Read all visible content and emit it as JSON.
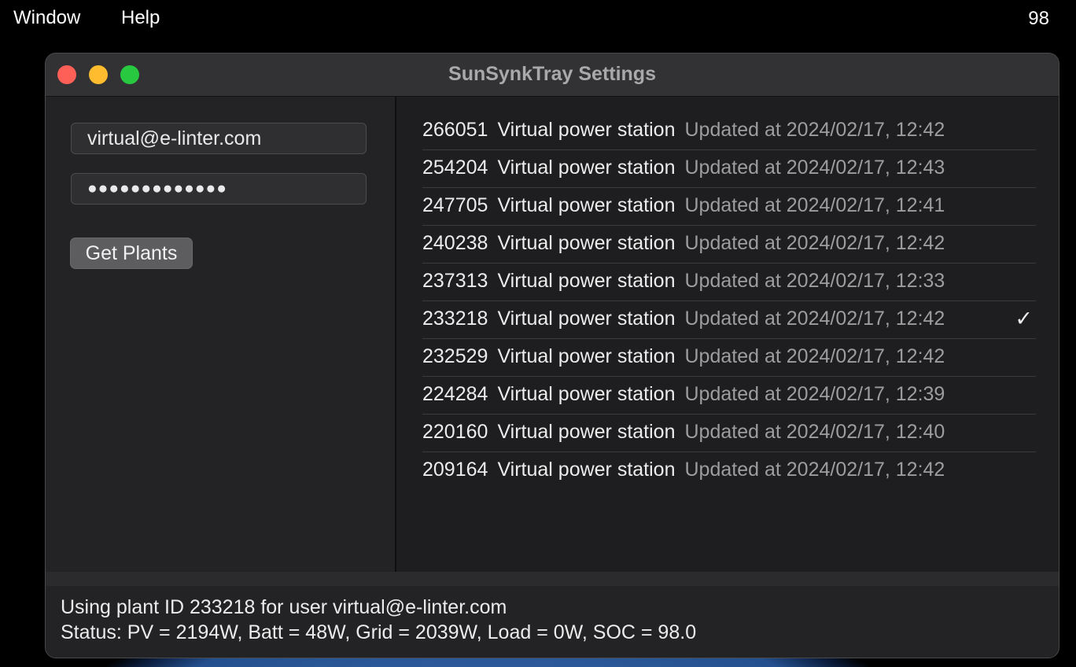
{
  "menubar": {
    "items": [
      "Window",
      "Help"
    ],
    "right_text": "98"
  },
  "window": {
    "title": "SunSynkTray Settings"
  },
  "login": {
    "email": "virtual@e-linter.com",
    "password_mask": "●●●●●●●●●●●●●",
    "get_plants_label": "Get Plants"
  },
  "plants": [
    {
      "id": "266051",
      "name": "Virtual power station",
      "updated": "Updated at 2024/02/17, 12:42",
      "selected": false
    },
    {
      "id": "254204",
      "name": "Virtual power station",
      "updated": "Updated at 2024/02/17, 12:43",
      "selected": false
    },
    {
      "id": "247705",
      "name": "Virtual power station",
      "updated": "Updated at 2024/02/17, 12:41",
      "selected": false
    },
    {
      "id": "240238",
      "name": "Virtual power station",
      "updated": "Updated at 2024/02/17, 12:42",
      "selected": false
    },
    {
      "id": "237313",
      "name": "Virtual power station",
      "updated": "Updated at 2024/02/17, 12:33",
      "selected": false
    },
    {
      "id": "233218",
      "name": "Virtual power station",
      "updated": "Updated at 2024/02/17, 12:42",
      "selected": true,
      "mark": "✓"
    },
    {
      "id": "232529",
      "name": "Virtual power station",
      "updated": "Updated at 2024/02/17, 12:42",
      "selected": false
    },
    {
      "id": "224284",
      "name": "Virtual power station",
      "updated": "Updated at 2024/02/17, 12:39",
      "selected": false
    },
    {
      "id": "220160",
      "name": "Virtual power station",
      "updated": "Updated at 2024/02/17, 12:40",
      "selected": false
    },
    {
      "id": "209164",
      "name": "Virtual power station",
      "updated": "Updated at 2024/02/17, 12:42",
      "selected": false
    }
  ],
  "status": {
    "line1": "Using plant ID 233218 for user virtual@e-linter.com",
    "line2": "Status: PV = 2194W, Batt = 48W, Grid = 2039W, Load = 0W, SOC = 98.0"
  },
  "colors": {
    "close": "#fe5f57",
    "minimize": "#febc2e",
    "maximize": "#28c840"
  }
}
